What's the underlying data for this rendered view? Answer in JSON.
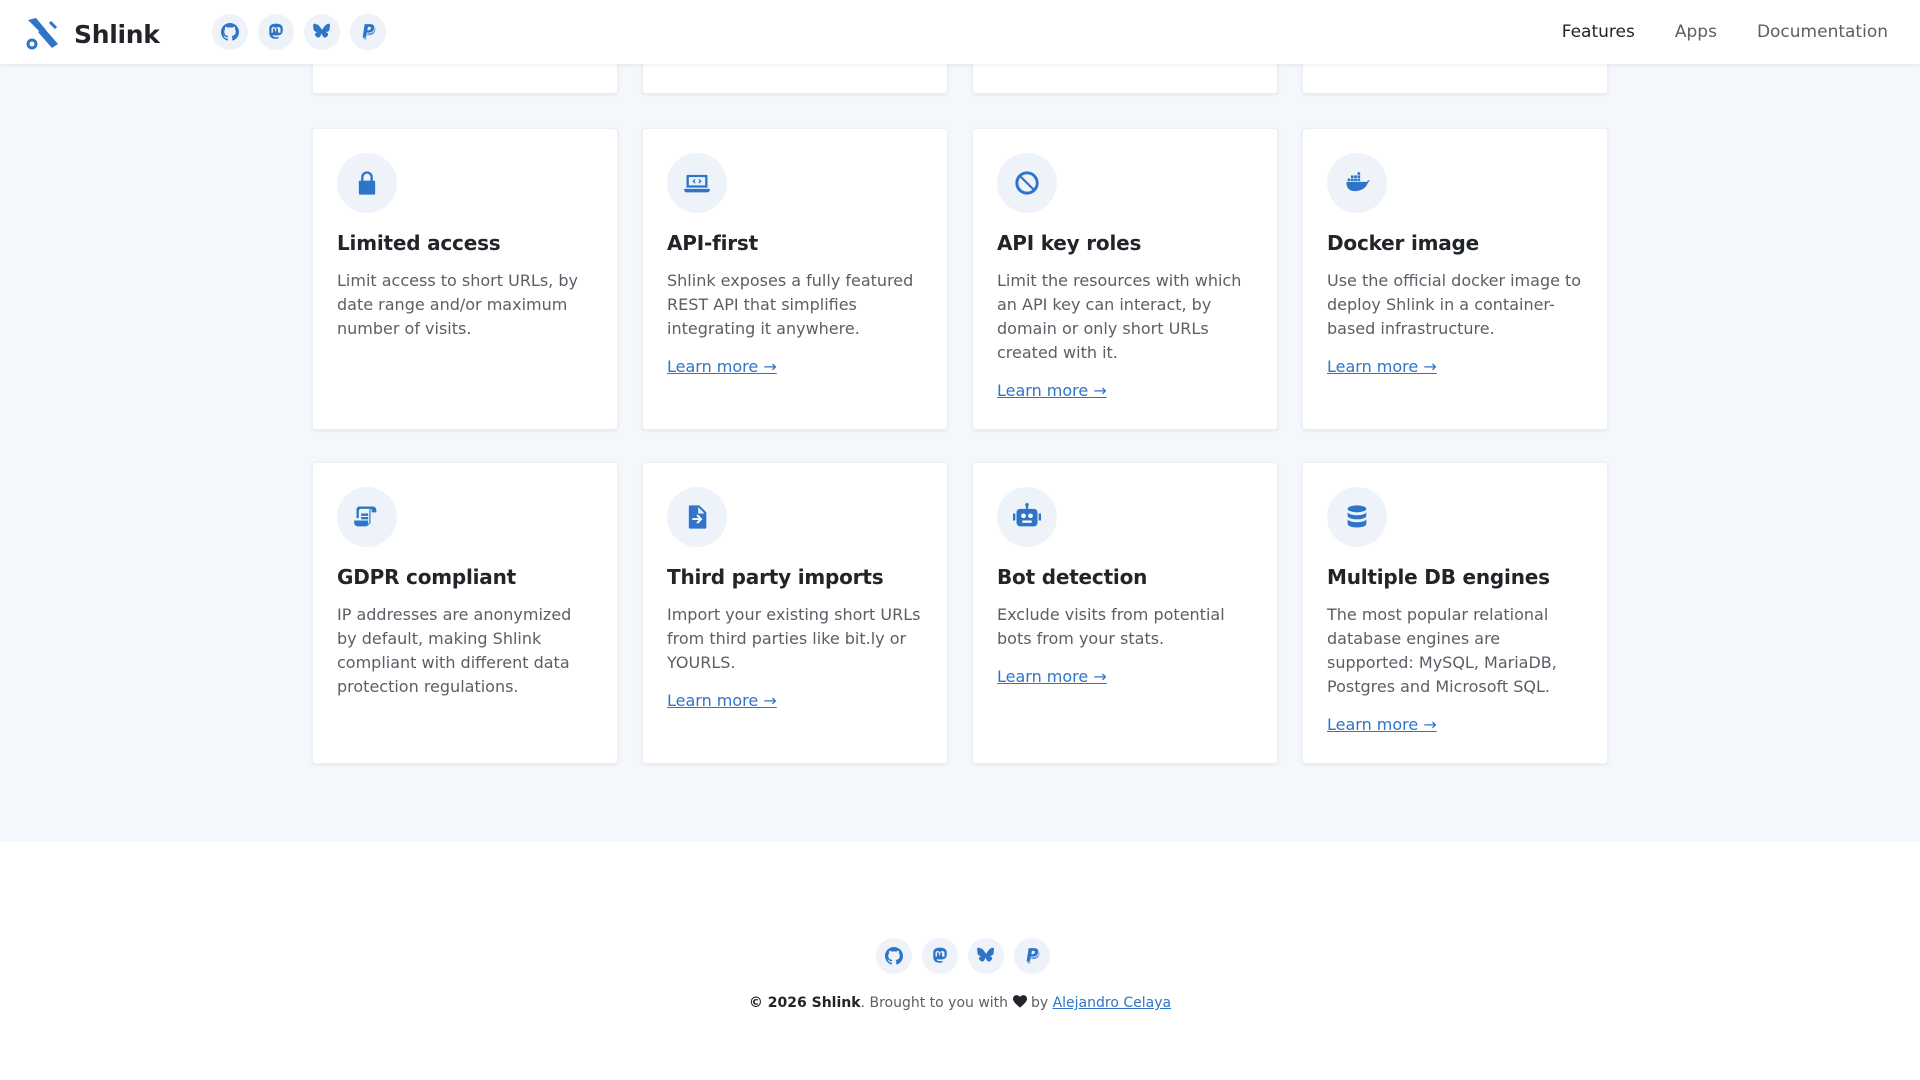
{
  "header": {
    "brand": "Shlink",
    "social": [
      "github-icon",
      "mastodon-icon",
      "bluesky-icon",
      "paypal-icon"
    ],
    "nav": [
      "Features",
      "Apps",
      "Documentation"
    ],
    "active_nav": "Features"
  },
  "cards": {
    "learn_more": "Learn more →",
    "row1": [
      {
        "icon": "lock-icon",
        "title": "Limited access",
        "desc": "Limit access to short URLs, by date range and/or maximum number of visits."
      },
      {
        "icon": "laptop-code-icon",
        "title": "API-first",
        "desc": "Shlink exposes a fully featured REST API that simplifies integrating it anywhere."
      },
      {
        "icon": "ban-icon",
        "title": "API key roles",
        "desc": "Limit the resources with which an API key can interact, by domain or only short URLs created with it."
      },
      {
        "icon": "docker-icon",
        "title": "Docker image",
        "desc": "Use the official docker image to deploy Shlink in a container-based infrastructure."
      }
    ],
    "row2": [
      {
        "icon": "scroll-icon",
        "title": "GDPR compliant",
        "desc": "IP addresses are anonymized by default, making Shlink compliant with different data protection regulations."
      },
      {
        "icon": "file-import-icon",
        "title": "Third party imports",
        "desc": "Import your existing short URLs from third parties like bit.ly or YOURLS."
      },
      {
        "icon": "robot-icon",
        "title": "Bot detection",
        "desc": "Exclude visits from potential bots from your stats."
      },
      {
        "icon": "database-icon",
        "title": "Multiple DB engines",
        "desc": "The most popular relational database engines are supported: MySQL, MariaDB, Postgres and Microsoft SQL."
      }
    ]
  },
  "footer": {
    "copyright_strong": "© 2026 Shlink",
    "text_before_heart": ". Brought to you with",
    "text_after_heart": "by",
    "author": "Alejandro Celaya"
  },
  "colors": {
    "accent": "#2e74c9",
    "background": "#f4f7fb",
    "card": "#ffffff",
    "text": "#212529",
    "muted": "#5a5f66"
  }
}
